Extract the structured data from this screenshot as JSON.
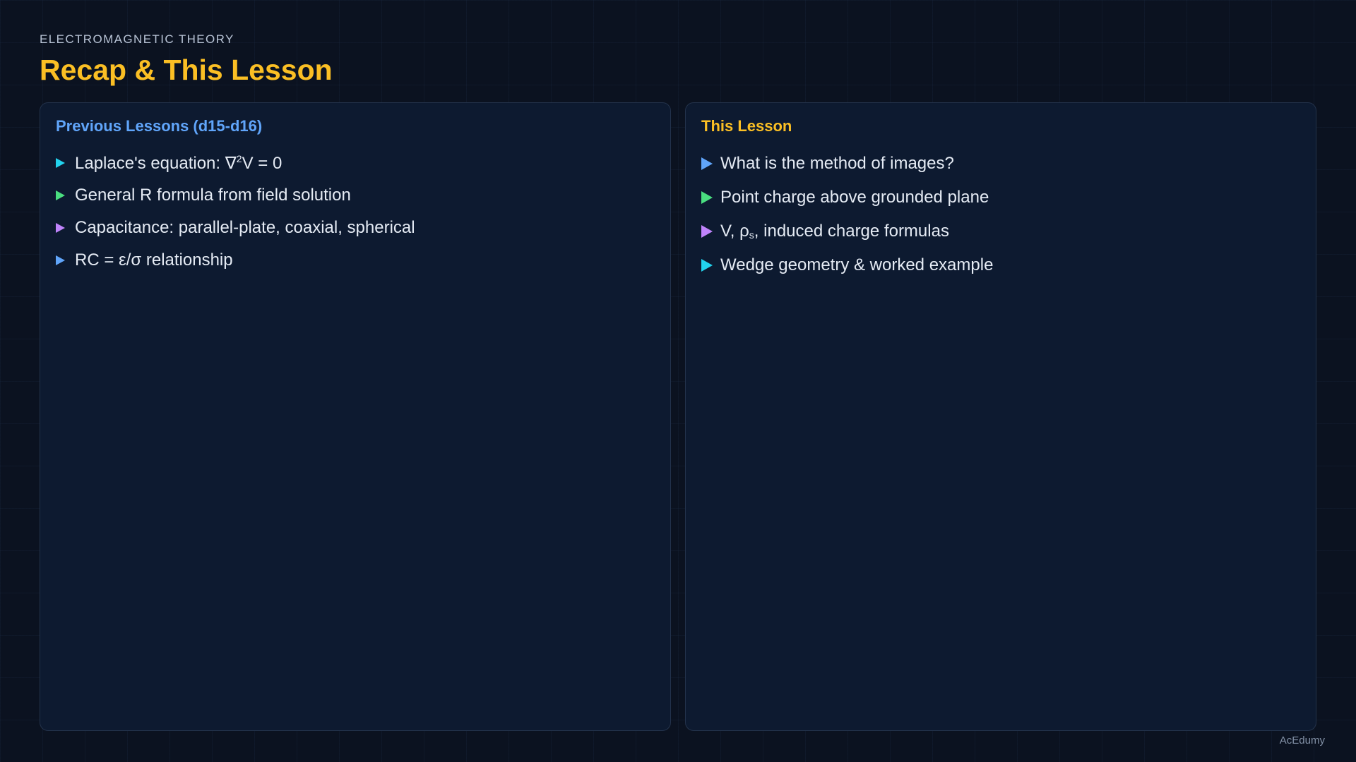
{
  "header": {
    "subject": "ELECTROMAGNETIC THEORY",
    "title": "Recap & This Lesson"
  },
  "left_panel": {
    "heading": "Previous Lessons (d15-d16)",
    "items": [
      {
        "text_before": "Laplace's equation: ∇",
        "sup": "2",
        "text_after": "V = 0",
        "arrow_color": "#22d3ee"
      },
      {
        "text": "General R formula from field solution",
        "arrow_color": "#4ade80"
      },
      {
        "text": "Capacitance: parallel-plate, coaxial, spherical",
        "arrow_color": "#c084fc"
      },
      {
        "text": "RC = ε/σ relationship",
        "arrow_color": "#60a5fa"
      }
    ]
  },
  "right_panel": {
    "heading": "This Lesson",
    "items": [
      {
        "text": "What is the method of images?",
        "arrow_color": "#60a5fa"
      },
      {
        "text": "Point charge above grounded plane",
        "arrow_color": "#4ade80"
      },
      {
        "text_before": "V, ρ",
        "sub": "s",
        "text_after": ", induced charge formulas",
        "arrow_color": "#c084fc"
      },
      {
        "text": "Wedge geometry & worked example",
        "arrow_color": "#22d3ee"
      }
    ]
  },
  "footer": {
    "brand": "AcEdumy"
  },
  "icons": {
    "bullet": "triangle-right-icon"
  }
}
